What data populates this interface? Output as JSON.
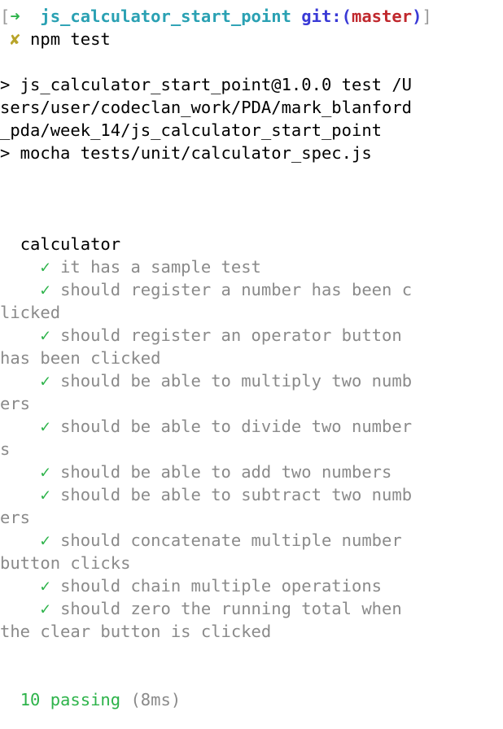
{
  "prompt": {
    "open_bracket": "[",
    "arrow": "➜",
    "directory": "js_calculator_start_point",
    "git_label": "git:",
    "paren_open": "(",
    "branch": "master",
    "paren_close": ")",
    "close_bracket": "]"
  },
  "command_line": {
    "mark": "✘",
    "command": "npm test"
  },
  "script_output": [
    "> js_calculator_start_point@1.0.0 test /U",
    "sers/user/codeclan_work/PDA/mark_blanford",
    "_pda/week_14/js_calculator_start_point",
    "> mocha tests/unit/calculator_spec.js"
  ],
  "suite_name": "calculator",
  "check_glyph": "✓",
  "tests": [
    {
      "first": "it has a sample test",
      "cont": ""
    },
    {
      "first": "should register a number has been c",
      "cont": "licked"
    },
    {
      "first": "should register an operator button",
      "cont": "has been clicked"
    },
    {
      "first": "should be able to multiply two numb",
      "cont": "ers"
    },
    {
      "first": "should be able to divide two number",
      "cont": "s"
    },
    {
      "first": "should be able to add two numbers",
      "cont": ""
    },
    {
      "first": "should be able to subtract two numb",
      "cont": "ers"
    },
    {
      "first": "should concatenate multiple number",
      "cont": "button clicks"
    },
    {
      "first": "should chain multiple operations",
      "cont": ""
    },
    {
      "first": "should zero the running total when",
      "cont": "the clear button is clicked"
    }
  ],
  "summary": {
    "passing": "10 passing",
    "duration": "(8ms)"
  },
  "colors": {
    "arrow": "#2db34a",
    "directory": "#2aa1b3",
    "git": "#3a3ad6",
    "branch": "#c0282d",
    "x_mark": "#b8a42a",
    "pass": "#2db34a",
    "muted": "#8a8a8a"
  }
}
